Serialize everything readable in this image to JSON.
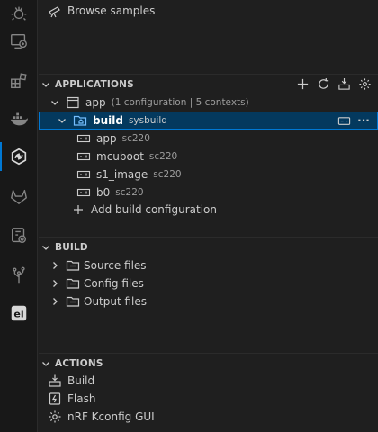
{
  "activity_bar": {
    "icons": [
      "debug-icon",
      "remote-explorer-icon",
      "extensions-icon",
      "docker-icon",
      "nrf-connect-icon",
      "gitlab-icon",
      "device-settings-icon",
      "source-tree-icon",
      "el-icon"
    ],
    "el_label": "el",
    "active": "nrf-connect-icon"
  },
  "welcome": {
    "browse_samples": "Browse samples"
  },
  "applications": {
    "title": "APPLICATIONS",
    "app": {
      "name": "app",
      "meta": "(1 configuration | 5 contexts)"
    },
    "build": {
      "name": "build",
      "tag": "sysbuild",
      "more": "···"
    },
    "images": [
      {
        "name": "app",
        "board": "sc220"
      },
      {
        "name": "mcuboot",
        "board": "sc220"
      },
      {
        "name": "s1_image",
        "board": "sc220"
      },
      {
        "name": "b0",
        "board": "sc220"
      }
    ],
    "add_build": "Add build configuration"
  },
  "build_section": {
    "title": "BUILD",
    "items": [
      {
        "label": "Source files"
      },
      {
        "label": "Config files"
      },
      {
        "label": "Output files"
      }
    ]
  },
  "actions": {
    "title": "ACTIONS",
    "items": [
      {
        "label": "Build"
      },
      {
        "label": "Flash"
      },
      {
        "label": "nRF Kconfig GUI"
      }
    ]
  },
  "colors": {
    "accent": "#0078d4",
    "selection": "#04395e",
    "background": "#1f1f1f",
    "activity_bar": "#181818"
  }
}
